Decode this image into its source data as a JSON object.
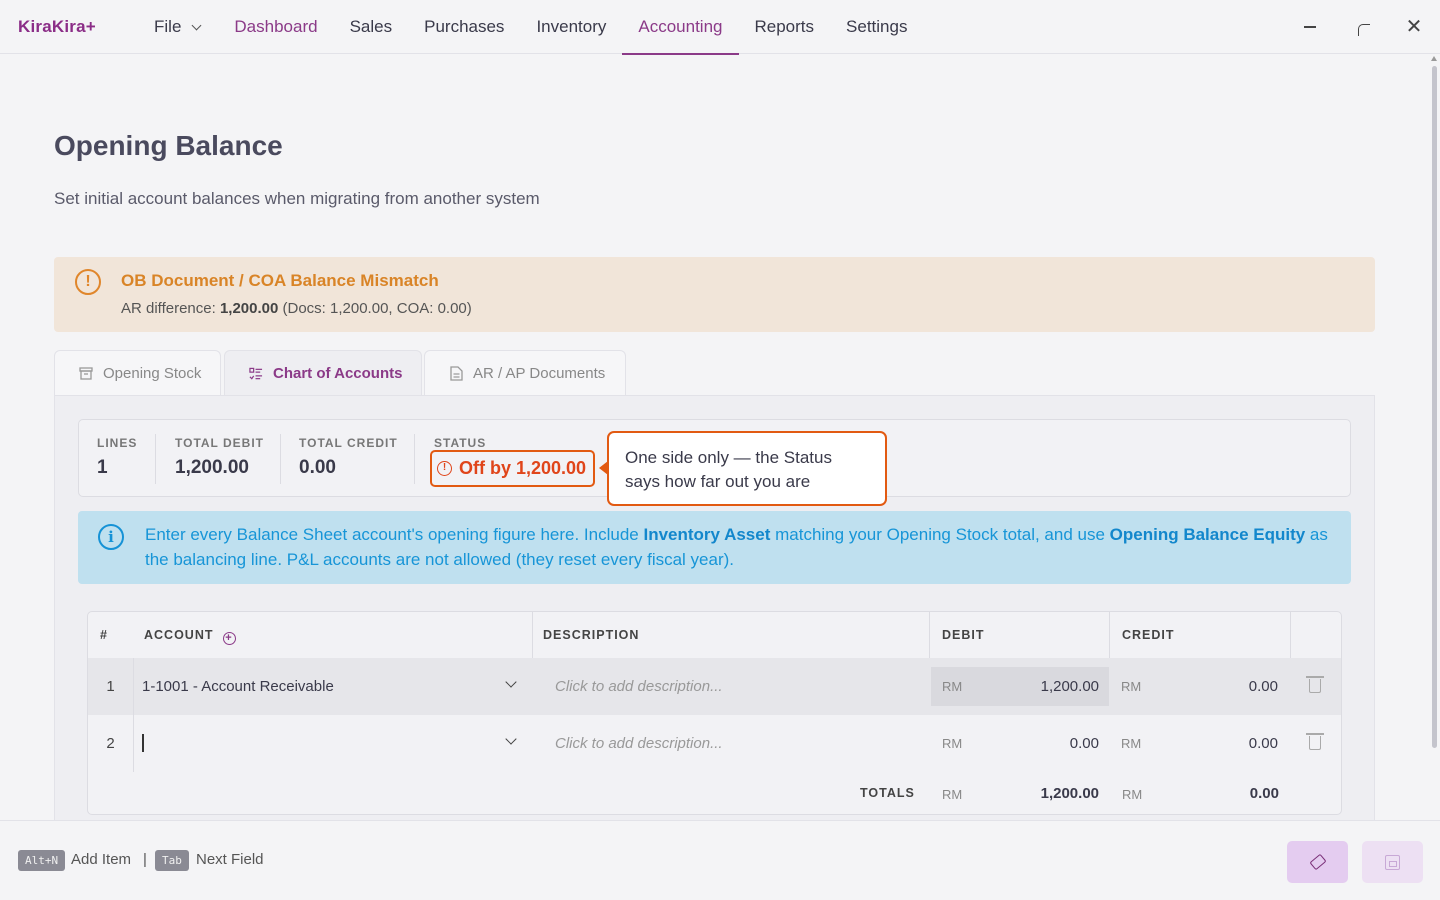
{
  "app": {
    "name": "KiraKira+"
  },
  "nav": {
    "file": "File",
    "items": [
      {
        "id": "dashboard",
        "label": "Dashboard"
      },
      {
        "id": "sales",
        "label": "Sales"
      },
      {
        "id": "purchases",
        "label": "Purchases"
      },
      {
        "id": "inventory",
        "label": "Inventory"
      },
      {
        "id": "accounting",
        "label": "Accounting"
      },
      {
        "id": "reports",
        "label": "Reports"
      },
      {
        "id": "settings",
        "label": "Settings"
      }
    ],
    "active": "Accounting"
  },
  "window": {
    "close_glyph": "✕"
  },
  "page": {
    "title": "Opening Balance",
    "subtitle": "Set initial account balances when migrating from another system"
  },
  "warning": {
    "icon": "!",
    "title": "OB Document / COA Balance Mismatch",
    "detail_prefix": "AR difference: ",
    "detail_value": "1,200.00",
    "detail_suffix": " (Docs: 1,200.00, COA: 0.00)"
  },
  "tabs": [
    {
      "label": "Opening Stock",
      "icon": "box-icon"
    },
    {
      "label": "Chart of Accounts",
      "icon": "list-icon"
    },
    {
      "label": "AR / AP Documents",
      "icon": "document-icon"
    }
  ],
  "active_tab": "Chart of Accounts",
  "stats": {
    "lines_label": "LINES",
    "lines_value": "1",
    "debit_label": "TOTAL DEBIT",
    "debit_value": "1,200.00",
    "credit_label": "TOTAL CREDIT",
    "credit_value": "0.00",
    "status_label": "STATUS",
    "status_value": "Off by 1,200.00"
  },
  "tooltip": {
    "line1": "One side only — the Status",
    "line2": "says how far out you are"
  },
  "info": {
    "icon": "i",
    "text_1": "Enter every Balance Sheet account's opening figure here. Include ",
    "bold_1": "Inventory Asset",
    "text_2": " matching your Opening Stock total, and use ",
    "bold_2": "Opening Balance Equity",
    "text_3": " as the balancing line. P&L accounts are not allowed (they reset every fiscal year)."
  },
  "table": {
    "headers": {
      "num": "#",
      "account": "ACCOUNT",
      "description": "DESCRIPTION",
      "debit": "DEBIT",
      "credit": "CREDIT"
    },
    "add_glyph": "+",
    "currency": "RM",
    "rows": [
      {
        "num": "1",
        "account": "1-1001 - Account Receivable",
        "description_placeholder": "Click to add description...",
        "debit": "1,200.00",
        "credit": "0.00"
      },
      {
        "num": "2",
        "account": "",
        "description_placeholder": "Click to add description...",
        "debit": "0.00",
        "credit": "0.00"
      }
    ],
    "totals_label": "TOTALS",
    "total_debit": "1,200.00",
    "total_credit": "0.00"
  },
  "footer": {
    "shortcut_1_key": "Alt+N",
    "shortcut_1_label": "Add Item",
    "separator": "|",
    "shortcut_2_key": "Tab",
    "shortcut_2_label": "Next Field"
  },
  "colors": {
    "brand": "#8b3a88",
    "warning": "#d98427",
    "error": "#e0451a",
    "info": "#1795d7"
  }
}
